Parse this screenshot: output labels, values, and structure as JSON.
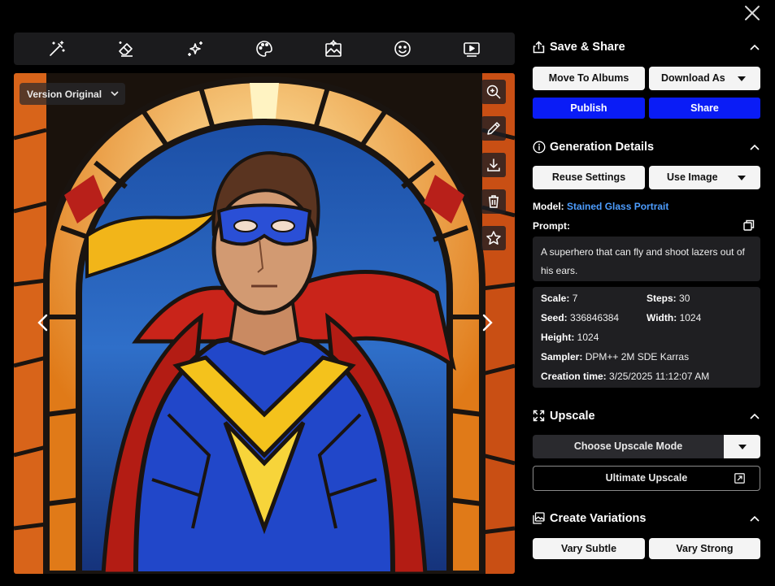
{
  "window": {
    "close_icon": "close-icon"
  },
  "toolbar": {
    "tools": [
      "magic-wand-icon",
      "eraser-icon",
      "sparkles-icon",
      "palette-icon",
      "image-edit-icon",
      "face-icon",
      "video-play-icon"
    ]
  },
  "viewer": {
    "version_label": "Version Original",
    "side_actions": [
      "zoom-in-icon",
      "pencil-icon",
      "download-icon",
      "trash-icon",
      "star-icon"
    ]
  },
  "save_share": {
    "title": "Save & Share",
    "move_to_albums": "Move To Albums",
    "download_as": "Download As",
    "publish": "Publish",
    "share": "Share"
  },
  "generation": {
    "title": "Generation Details",
    "reuse_settings": "Reuse Settings",
    "use_image": "Use Image",
    "model_label": "Model:",
    "model_value": "Stained Glass Portrait",
    "prompt_label": "Prompt:",
    "prompt_text": "A superhero that can fly and shoot lazers out of his ears.",
    "scale_label": "Scale:",
    "scale_value": "7",
    "steps_label": "Steps:",
    "steps_value": "30",
    "seed_label": "Seed:",
    "seed_value": "336846384",
    "width_label": "Width:",
    "width_value": "1024",
    "height_label": "Height:",
    "height_value": "1024",
    "sampler_label": "Sampler:",
    "sampler_value": "DPM++ 2M SDE Karras",
    "creation_label": "Creation time:",
    "creation_value": "3/25/2025 11:12:07 AM"
  },
  "upscale": {
    "title": "Upscale",
    "mode_placeholder": "Choose Upscale Mode",
    "ultimate": "Ultimate Upscale"
  },
  "variations": {
    "title": "Create Variations",
    "subtle": "Vary Subtle",
    "strong": "Vary Strong"
  },
  "colors": {
    "accent_blue": "#0a1cf6",
    "link_blue": "#4d9dff",
    "panel_bg": "#1f1f22"
  }
}
